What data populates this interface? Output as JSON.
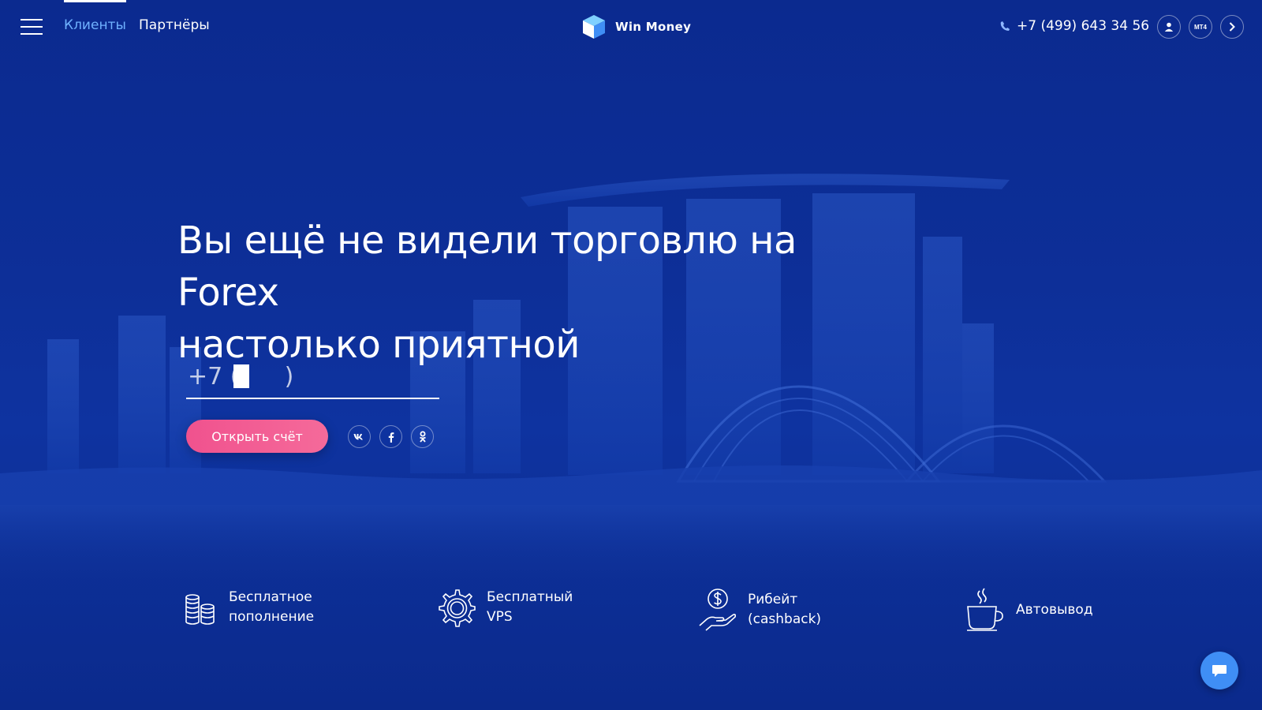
{
  "header": {
    "tabs": [
      {
        "label": "Клиенты",
        "active": true
      },
      {
        "label": "Партнёры",
        "active": false
      }
    ],
    "logo_text": "Win Money",
    "phone": "+7 (499) 643 34 56",
    "mt4_label": "MT4"
  },
  "hero": {
    "title_line1": "Вы ещё не видели торговлю на Forex",
    "title_line2": "настолько приятной",
    "phone_input_value": "+7 (      )",
    "cta_label": "Открыть счёт"
  },
  "social": [
    "vk-icon",
    "facebook-icon",
    "odnoklassniki-icon"
  ],
  "features": [
    {
      "line1": "Бесплатное",
      "line2": "пополнение",
      "icon": "coins-icon"
    },
    {
      "line1": "Бесплатный",
      "line2": "VPS",
      "icon": "gear-icon"
    },
    {
      "line1": "Рибейт",
      "line2": "(cashback)",
      "icon": "hand-dollar-icon"
    },
    {
      "line1": "Автовывод",
      "line2": "",
      "icon": "coffee-cup-icon"
    }
  ],
  "colors": {
    "background": "#0d2f98",
    "accent_tab": "#6fb1ff",
    "cta": "#f0528e",
    "chat": "#3f8ef5"
  }
}
